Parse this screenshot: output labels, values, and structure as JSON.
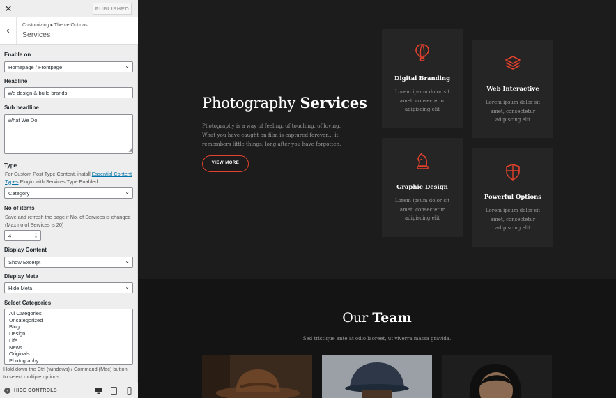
{
  "topbar": {
    "close_icon": "close-icon",
    "publish_label": "PUBLISHED"
  },
  "panel": {
    "breadcrumb": "Customizing ▸ Theme Options",
    "title": "Services"
  },
  "fields": {
    "enable_on": {
      "label": "Enable on",
      "value": "Homepage / Frontpage"
    },
    "headline": {
      "label": "Headline",
      "value": "We design & build brands"
    },
    "sub_headline": {
      "label": "Sub headline",
      "value": "What We Do"
    },
    "type": {
      "label": "Type",
      "desc_before": "For Custom Post Type Content, install ",
      "desc_link": "Essential Content Types",
      "desc_after": " Plugin with Services Type Enabled",
      "value": "Category"
    },
    "no_items": {
      "label": "No of items",
      "desc": "Save and refresh the page if No. of Services is changed (Max no of Services is 20)",
      "value": "4"
    },
    "display_content": {
      "label": "Display Content",
      "value": "Show Excerpt"
    },
    "display_meta": {
      "label": "Display Meta",
      "value": "Hide Meta"
    },
    "select_categories": {
      "label": "Select Categories",
      "options": [
        "All Categories",
        "Uncategorized",
        "Blog",
        "Design",
        "Life",
        "News",
        "Originals",
        "Photography"
      ],
      "help": "Hold down the Ctrl (windows) / Command (Mac) button to select multiple options."
    }
  },
  "footer": {
    "hide_label": "HIDE CONTROLS"
  },
  "preview": {
    "services": {
      "title_light": "Photography",
      "title_bold": "Services",
      "text": "Photography is a way of feeling, of touching, of loving. What you have caught on film is captured forever… it remembers little things, long after you have forgotten.",
      "button": "VIEW MORE"
    },
    "cards": [
      {
        "icon": "hot-air-balloon-icon",
        "title": "Digital Branding",
        "text": "Lorem ipsum dolor sit amet, consectetur adipiscing elit"
      },
      {
        "icon": "layers-icon",
        "title": "Web Interactive",
        "text": "Lorem ipsum dolor sit amet, consectetur adipiscing elit"
      },
      {
        "icon": "chess-knight-icon",
        "title": "Graphic Design",
        "text": "Lorem ipsum dolor sit amet, consectetur adipiscing elit"
      },
      {
        "icon": "shield-icon",
        "title": "Powerful Options",
        "text": "Lorem ipsum dolor sit amet, consectetur adipiscing elit"
      }
    ],
    "team": {
      "title_light": "Our",
      "title_bold": "Team",
      "subtitle": "Sed tristique ante at odio laoreet, ut viverra massa gravida."
    },
    "colors": {
      "accent": "#e2412d",
      "background": "#1c1c1c",
      "card": "#252525"
    }
  }
}
